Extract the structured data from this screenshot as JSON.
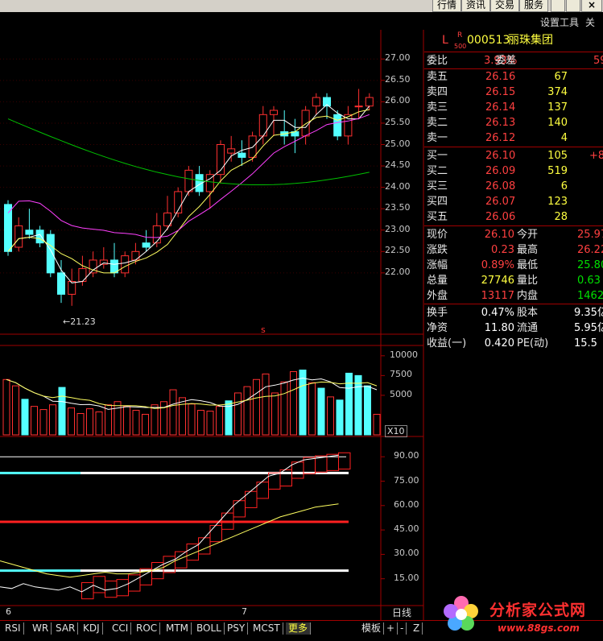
{
  "topbar": {
    "buttons": [
      "行情",
      "资讯",
      "交易",
      "服务"
    ],
    "close_glyph": "×"
  },
  "toolbar": {
    "settings": "设置工具",
    "close": "关闭"
  },
  "stock": {
    "prefix": "L",
    "badge_top": "R",
    "badge_bottom": "500",
    "code": "000513",
    "name": "丽珠集团"
  },
  "quote_rows": {
    "weibi": {
      "label": "委比",
      "value": "3.93%",
      "label2": "委差",
      "value2": "59"
    },
    "sells": [
      {
        "label": "卖五",
        "price": "26.16",
        "vol": "67"
      },
      {
        "label": "卖四",
        "price": "26.15",
        "vol": "374"
      },
      {
        "label": "卖三",
        "price": "26.14",
        "vol": "137"
      },
      {
        "label": "卖二",
        "price": "26.13",
        "vol": "140"
      },
      {
        "label": "卖一",
        "price": "26.12",
        "vol": "4"
      }
    ],
    "buys": [
      {
        "label": "买一",
        "price": "26.10",
        "vol": "105",
        "extra": "+89"
      },
      {
        "label": "买二",
        "price": "26.09",
        "vol": "519",
        "extra": ""
      },
      {
        "label": "买三",
        "price": "26.08",
        "vol": "6",
        "extra": ""
      },
      {
        "label": "买四",
        "price": "26.07",
        "vol": "123",
        "extra": ""
      },
      {
        "label": "买五",
        "price": "26.06",
        "vol": "28",
        "extra": ""
      }
    ],
    "stats": [
      {
        "l1": "现价",
        "v1": "26.10",
        "c1": "red",
        "l2": "今开",
        "v2": "25.97",
        "c2": "red"
      },
      {
        "l1": "涨跌",
        "v1": "0.23",
        "c1": "red",
        "l2": "最高",
        "v2": "26.22",
        "c2": "red"
      },
      {
        "l1": "涨幅",
        "v1": "0.89%",
        "c1": "red",
        "l2": "最低",
        "v2": "25.80",
        "c2": "green"
      },
      {
        "l1": "总量",
        "v1": "27746",
        "c1": "yellow",
        "l2": "量比",
        "v2": "0.63",
        "c2": "green"
      },
      {
        "l1": "外盘",
        "v1": "13117",
        "c1": "red",
        "l2": "内盘",
        "v2": "14629",
        "c2": "green"
      }
    ],
    "fund": [
      {
        "l1": "换手",
        "v1": "0.47%",
        "l2": "股本",
        "v2": "9.35亿"
      },
      {
        "l1": "净资",
        "v1": "11.80",
        "l2": "流通",
        "v2": "5.95亿"
      },
      {
        "l1": "收益(一)",
        "v1": "0.420",
        "l2": "PE(动)",
        "v2": "15.5"
      }
    ]
  },
  "price_axis": [
    "27.00",
    "26.50",
    "26.00",
    "25.50",
    "25.00",
    "24.50",
    "24.00",
    "23.50",
    "23.00",
    "22.50",
    "22.00"
  ],
  "low_marker": "←21.23",
  "s_marker": "s",
  "volume_axis": [
    "10000",
    "7500",
    "5000"
  ],
  "volume_unit": "X10",
  "kdj_axis": [
    "90.00",
    "75.00",
    "60.00",
    "45.00",
    "30.00",
    "15.00"
  ],
  "date_labels": [
    "6",
    "7"
  ],
  "period": "日线",
  "tabs": [
    "RSI",
    "WR",
    "SAR",
    "KDJ",
    "CCI",
    "ROC",
    "MTM",
    "BOLL",
    "PSY",
    "MCST",
    "更多"
  ],
  "tab_right": [
    "模板",
    "+",
    "-",
    "Z"
  ],
  "logo": {
    "title": "分析家公式网",
    "url": "www.88gs.com"
  },
  "colors": {
    "up": "#ff3030",
    "down": "#54ffff",
    "ma5": "#ffffff",
    "ma10": "#ffff60",
    "ma20": "#ff40ff",
    "ma60": "#00c000",
    "grid": "#a00000"
  },
  "chart_data": [
    {
      "type": "candlestick",
      "yaxis_ticks": [
        27.0,
        26.5,
        26.0,
        25.5,
        25.0,
        24.5,
        24.0,
        23.5,
        23.0,
        22.5,
        22.0
      ],
      "candles": [
        {
          "o": 23.6,
          "c": 22.5,
          "h": 23.7,
          "l": 22.4
        },
        {
          "o": 22.6,
          "c": 23.1,
          "h": 23.3,
          "l": 22.5
        },
        {
          "o": 23.0,
          "c": 22.9,
          "h": 23.5,
          "l": 22.8
        },
        {
          "o": 23.0,
          "c": 22.7,
          "h": 23.1,
          "l": 22.6
        },
        {
          "o": 22.9,
          "c": 22.0,
          "h": 23.0,
          "l": 21.9
        },
        {
          "o": 22.0,
          "c": 21.5,
          "h": 22.3,
          "l": 21.3
        },
        {
          "o": 21.5,
          "c": 21.8,
          "h": 22.1,
          "l": 21.23
        },
        {
          "o": 21.8,
          "c": 22.1,
          "h": 22.4,
          "l": 21.7
        },
        {
          "o": 22.0,
          "c": 22.3,
          "h": 22.5,
          "l": 21.9
        },
        {
          "o": 22.2,
          "c": 22.3,
          "h": 22.6,
          "l": 22.1
        },
        {
          "o": 22.3,
          "c": 22.0,
          "h": 22.7,
          "l": 21.9
        },
        {
          "o": 22.0,
          "c": 22.4,
          "h": 22.5,
          "l": 21.9
        },
        {
          "o": 22.3,
          "c": 22.5,
          "h": 22.7,
          "l": 22.2
        },
        {
          "o": 22.7,
          "c": 22.6,
          "h": 23.0,
          "l": 22.5
        },
        {
          "o": 22.7,
          "c": 23.1,
          "h": 23.4,
          "l": 22.6
        },
        {
          "o": 23.1,
          "c": 23.4,
          "h": 23.8,
          "l": 23.0
        },
        {
          "o": 23.4,
          "c": 23.9,
          "h": 24.0,
          "l": 23.3
        },
        {
          "o": 23.9,
          "c": 24.4,
          "h": 24.5,
          "l": 23.8
        },
        {
          "o": 24.3,
          "c": 23.9,
          "h": 24.5,
          "l": 23.8
        },
        {
          "o": 23.9,
          "c": 24.3,
          "h": 24.4,
          "l": 23.5
        },
        {
          "o": 24.3,
          "c": 25.0,
          "h": 25.1,
          "l": 24.1
        },
        {
          "o": 24.8,
          "c": 24.9,
          "h": 25.2,
          "l": 24.6
        },
        {
          "o": 24.8,
          "c": 24.7,
          "h": 25.1,
          "l": 24.5
        },
        {
          "o": 24.7,
          "c": 25.2,
          "h": 25.3,
          "l": 24.6
        },
        {
          "o": 25.2,
          "c": 25.7,
          "h": 25.9,
          "l": 25.0
        },
        {
          "o": 25.7,
          "c": 25.8,
          "h": 25.9,
          "l": 25.2
        },
        {
          "o": 25.3,
          "c": 25.2,
          "h": 25.8,
          "l": 25.0
        },
        {
          "o": 25.3,
          "c": 25.2,
          "h": 25.6,
          "l": 24.8
        },
        {
          "o": 25.2,
          "c": 25.8,
          "h": 25.9,
          "l": 25.0
        },
        {
          "o": 25.9,
          "c": 26.1,
          "h": 26.2,
          "l": 25.7
        },
        {
          "o": 26.1,
          "c": 25.9,
          "h": 26.2,
          "l": 25.6
        },
        {
          "o": 25.7,
          "c": 25.2,
          "h": 25.8,
          "l": 25.1
        },
        {
          "o": 25.2,
          "c": 25.7,
          "h": 25.9,
          "l": 25.0
        },
        {
          "o": 25.9,
          "c": 25.9,
          "h": 26.3,
          "l": 25.6
        },
        {
          "o": 25.9,
          "c": 26.1,
          "h": 26.2,
          "l": 25.8
        }
      ]
    },
    {
      "type": "bar",
      "yaxis_ticks": [
        10000,
        7500,
        5000
      ],
      "values": [
        7000,
        6200,
        4500,
        3600,
        3200,
        3800,
        6000,
        3400,
        2700,
        3300,
        2900,
        3800,
        4200,
        3600,
        3100,
        2600,
        3800,
        4200,
        5700,
        4700,
        3900,
        3100,
        3000,
        3600,
        4300,
        5300,
        6100,
        7000,
        7700,
        5300,
        6700,
        8000,
        8200,
        6600,
        5900,
        4800,
        4400,
        7800,
        7500,
        6200,
        2600
      ],
      "colors_up": [
        true,
        true,
        false,
        true,
        true,
        true,
        false,
        true,
        true,
        true,
        true,
        true,
        true,
        true,
        true,
        true,
        true,
        true,
        true,
        true,
        true,
        true,
        true,
        true,
        false,
        true,
        true,
        true,
        true,
        true,
        true,
        true,
        false,
        true,
        false,
        true,
        false,
        false,
        false,
        false,
        true
      ]
    },
    {
      "type": "line",
      "yaxis_ticks": [
        90,
        75,
        60,
        45,
        30,
        15
      ],
      "series": [
        {
          "values": [
            10,
            9,
            12,
            10,
            9,
            8,
            10,
            7,
            11,
            8,
            9,
            12,
            16,
            20,
            24,
            27,
            32,
            36,
            44,
            52,
            60,
            66,
            72,
            78,
            80,
            85,
            88,
            89,
            90,
            91
          ]
        },
        {
          "values": [
            26,
            24,
            22,
            20,
            18,
            17,
            16,
            17,
            18,
            19,
            18,
            18,
            19,
            20,
            22,
            26,
            29,
            32,
            35,
            38,
            41,
            44,
            47,
            50,
            53,
            55,
            57,
            59,
            60,
            61
          ]
        }
      ]
    }
  ]
}
